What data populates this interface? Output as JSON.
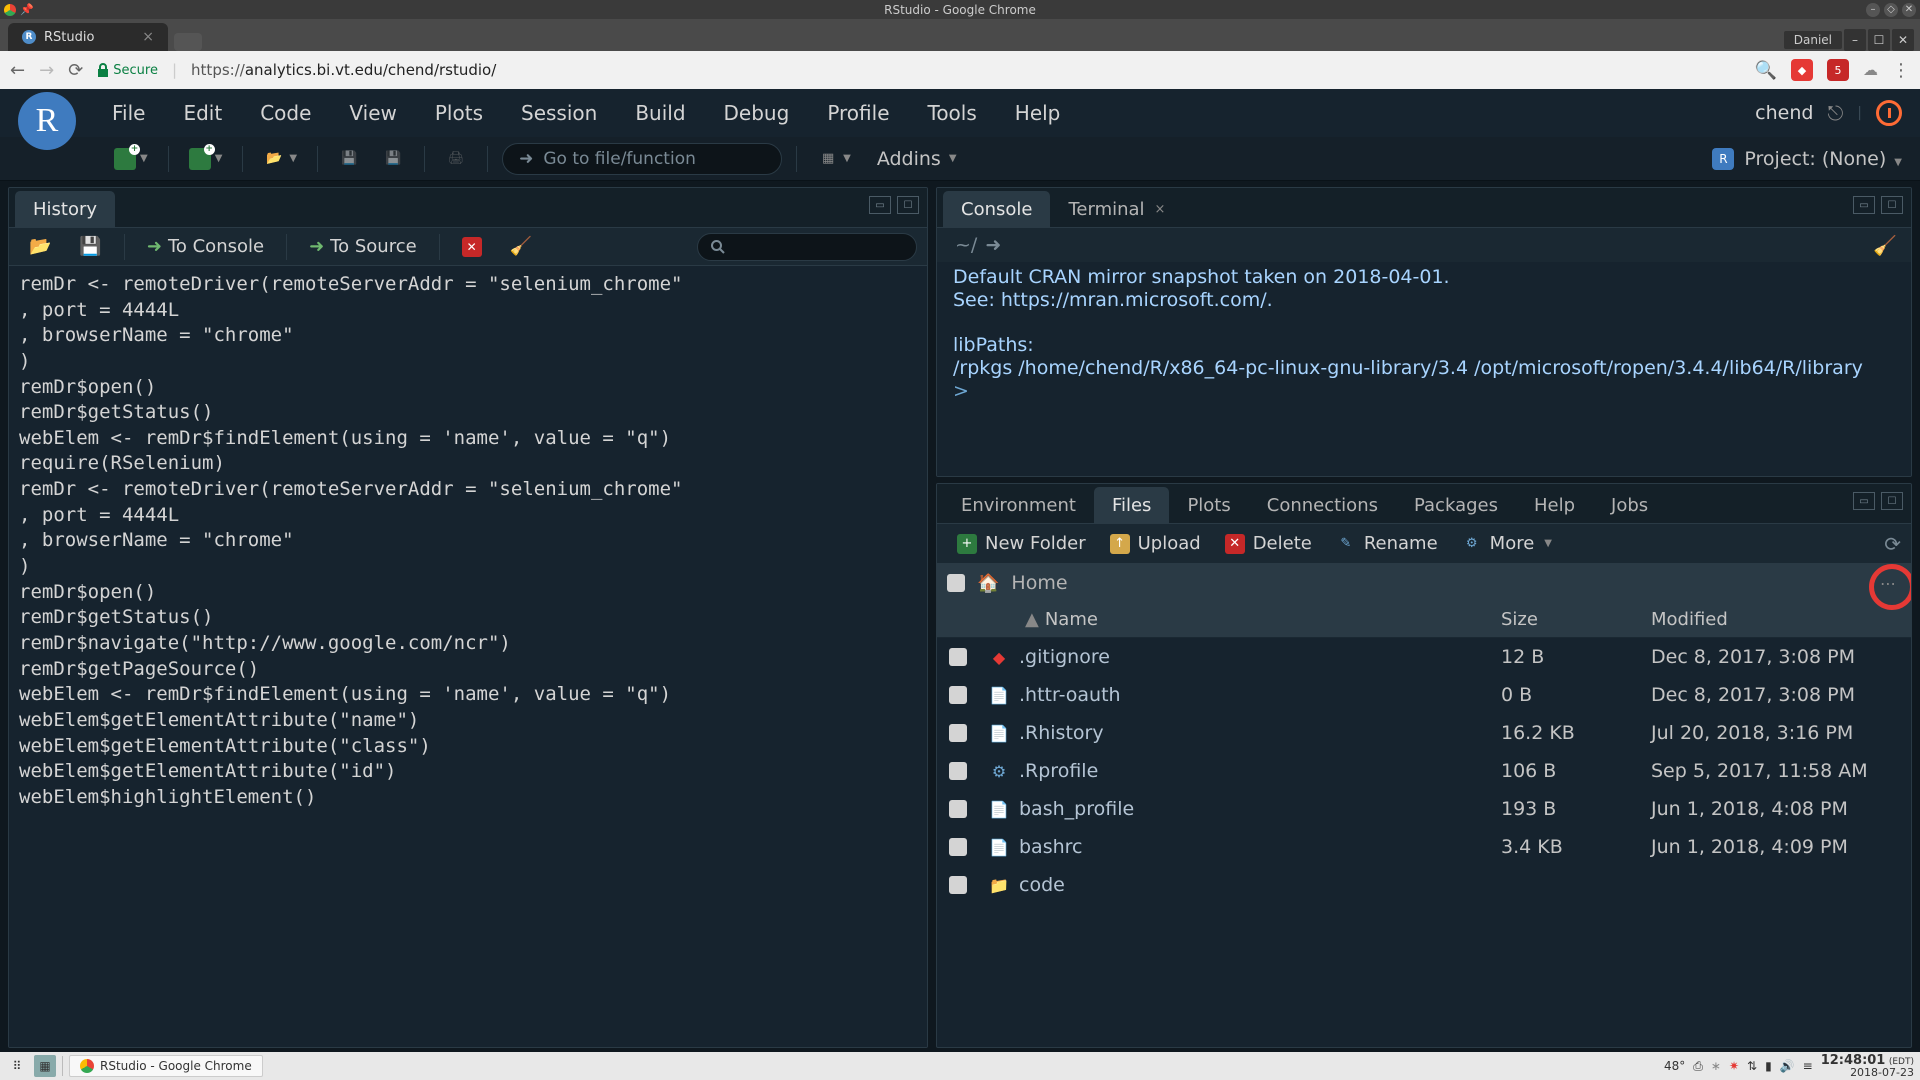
{
  "gnome": {
    "title": "RStudio - Google Chrome"
  },
  "chrome": {
    "tab_title": "RStudio",
    "user_label": "Daniel",
    "secure_label": "Secure",
    "url_proto": "https://",
    "url_rest": "analytics.bi.vt.edu/chend/rstudio/"
  },
  "menubar": {
    "items": [
      "File",
      "Edit",
      "Code",
      "View",
      "Plots",
      "Session",
      "Build",
      "Debug",
      "Profile",
      "Tools",
      "Help"
    ],
    "user": "chend"
  },
  "toolbar": {
    "goto_placeholder": "Go to file/function",
    "addins_label": "Addins",
    "project_label": "Project: (None)"
  },
  "left_pane": {
    "tab": "History",
    "to_console": "To Console",
    "to_source": "To Source",
    "code": "remDr <- remoteDriver(remoteServerAddr = \"selenium_chrome\"\n, port = 4444L\n, browserName = \"chrome\"\n)\nremDr$open()\nremDr$getStatus()\nwebElem <- remDr$findElement(using = 'name', value = \"q\")\nrequire(RSelenium)\nremDr <- remoteDriver(remoteServerAddr = \"selenium_chrome\"\n, port = 4444L\n, browserName = \"chrome\"\n)\nremDr$open()\nremDr$getStatus()\nremDr$navigate(\"http://www.google.com/ncr\")\nremDr$getPageSource()\nwebElem <- remDr$findElement(using = 'name', value = \"q\")\nwebElem$getElementAttribute(\"name\")\nwebElem$getElementAttribute(\"class\")\nwebElem$getElementAttribute(\"id\")\nwebElem$highlightElement()"
  },
  "console": {
    "tab1": "Console",
    "tab2": "Terminal",
    "path": "~/",
    "body": "Default CRAN mirror snapshot taken on 2018-04-01.\nSee: https://mran.microsoft.com/.\n\nlibPaths:\n/rpkgs /home/chend/R/x86_64-pc-linux-gnu-library/3.4 /opt/microsoft/ropen/3.4.4/lib64/R/library",
    "prompt": "> "
  },
  "files_pane": {
    "tabs": [
      "Environment",
      "Files",
      "Plots",
      "Connections",
      "Packages",
      "Help",
      "Jobs"
    ],
    "active_tab_index": 1,
    "btns": {
      "new_folder": "New Folder",
      "upload": "Upload",
      "delete": "Delete",
      "rename": "Rename",
      "more": "More"
    },
    "breadcrumb": "Home",
    "cols": {
      "name": "Name",
      "size": "Size",
      "modified": "Modified"
    },
    "rows": [
      {
        "name": ".gitignore",
        "size": "12 B",
        "modified": "Dec 8, 2017, 3:08 PM",
        "icon": "git"
      },
      {
        "name": ".httr-oauth",
        "size": "0 B",
        "modified": "Dec 8, 2017, 3:08 PM",
        "icon": "file"
      },
      {
        "name": ".Rhistory",
        "size": "16.2 KB",
        "modified": "Jul 20, 2018, 3:16 PM",
        "icon": "rhist"
      },
      {
        "name": ".Rprofile",
        "size": "106 B",
        "modified": "Sep 5, 2017, 11:58 AM",
        "icon": "rprof"
      },
      {
        "name": "bash_profile",
        "size": "193 B",
        "modified": "Jun 1, 2018, 4:08 PM",
        "icon": "file"
      },
      {
        "name": "bashrc",
        "size": "3.4 KB",
        "modified": "Jun 1, 2018, 4:09 PM",
        "icon": "file"
      },
      {
        "name": "code",
        "size": "",
        "modified": "",
        "icon": "folder"
      }
    ]
  },
  "taskbar": {
    "task": "RStudio - Google Chrome",
    "temp": "48°",
    "time": "12:48:01",
    "tz": "(EDT)",
    "date": "2018-07-23"
  }
}
